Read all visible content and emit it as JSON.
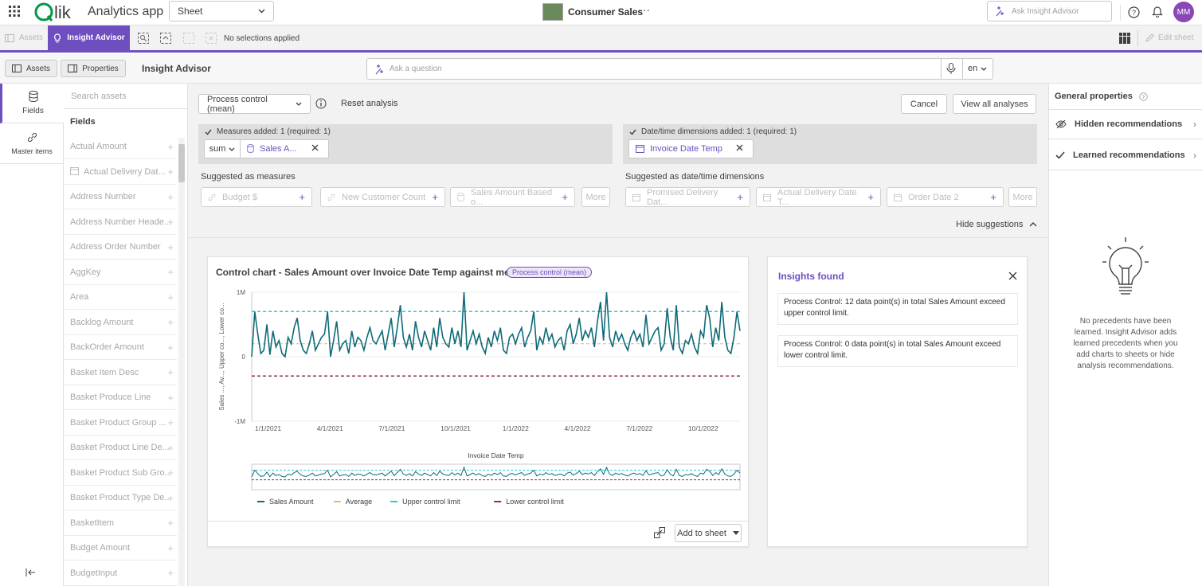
{
  "app": {
    "name": "Analytics app",
    "sheet_select": "Sheet",
    "doc_title": "Consumer Sales",
    "ask_placeholder": "Ask Insight Advisor",
    "avatar": "MM"
  },
  "toolbar": {
    "assets": "Assets",
    "insight_advisor": "Insight Advisor",
    "no_selections": "No selections applied",
    "edit_sheet": "Edit sheet"
  },
  "subbar": {
    "assets_tab": "Assets",
    "properties_tab": "Properties",
    "title": "Insight Advisor",
    "question_placeholder": "Ask a question",
    "language": "en"
  },
  "rail": {
    "fields": "Fields",
    "master_items": "Master items"
  },
  "fields_panel": {
    "search_placeholder": "Search assets",
    "heading": "Fields",
    "items": [
      "Actual Amount",
      "Actual Delivery Dat...",
      "Address Number",
      "Address Number Heade...",
      "Address Order Number",
      "AggKey",
      "Area",
      "Backlog Amount",
      "BackOrder Amount",
      "Basket Item Desc",
      "Basket Produce Line",
      "Basket Product Group ...",
      "Basket Product Line De...",
      "Basket Product Sub Gro...",
      "Basket Product Type De...",
      "BasketItem",
      "Budget Amount",
      "BudgetInput"
    ]
  },
  "analysis": {
    "type": "Process control (mean)",
    "reset": "Reset analysis",
    "cancel": "Cancel",
    "view_all": "View all analyses",
    "measures_header": "Measures added: 1 (required: 1)",
    "measure_agg": "sum",
    "measure_name": "Sales A...",
    "dims_header": "Date/time dimensions added: 1 (required: 1)",
    "dim_name": "Invoice Date Temp",
    "suggested_measures_label": "Suggested as measures",
    "suggested_measures": [
      "Budget $",
      "New Customer Count",
      "Sales Amount Based o..."
    ],
    "suggested_dims_label": "Suggested as date/time dimensions",
    "suggested_dims": [
      "Promised Delivery Dat...",
      "Actual Delivery Date T...",
      "Order Date 2"
    ],
    "more": "More",
    "hide_suggestions": "Hide suggestions"
  },
  "chart_card": {
    "title": "Control chart - Sales Amount over Invoice Date Temp against mean",
    "badge": "Process control (mean)",
    "add_to_sheet": "Add to sheet"
  },
  "chart_data": {
    "type": "line",
    "ylabel": "Sales ..., Av..., Upper co..., Lower co...",
    "xlabel": "Invoice Date Temp",
    "ylim": [
      -1000000,
      1000000
    ],
    "yticks": [
      "1M",
      "0",
      "-1M"
    ],
    "xticks": [
      "1/1/2021",
      "4/1/2021",
      "7/1/2021",
      "10/1/2021",
      "1/1/2022",
      "4/1/2022",
      "7/1/2022",
      "10/1/2022"
    ],
    "series": [
      {
        "name": "Sales Amount",
        "color": "#0e6b78",
        "values": [
          0,
          700000,
          350000,
          50000,
          100000,
          500000,
          30000,
          400000,
          150000,
          250000,
          50000,
          0,
          300000,
          200000,
          450000,
          600000,
          250000,
          100000,
          50000,
          200000,
          400000,
          100000,
          200000,
          300000,
          350000,
          700000,
          0,
          250000,
          550000,
          100000,
          200000,
          250000,
          50000,
          400000,
          150000,
          300000,
          250000,
          100000,
          300000,
          450000,
          250000,
          200000,
          300000,
          400000,
          100000,
          350000,
          600000,
          150000,
          450000,
          800000,
          300000,
          150000,
          350000,
          100000,
          550000,
          300000,
          150000,
          400000,
          250000,
          100000,
          450000,
          150000,
          600000,
          300000,
          200000,
          150000,
          450000,
          200000,
          400000,
          150000,
          1000000,
          100000,
          250000,
          400000,
          200000,
          350000,
          150000,
          50000,
          300000,
          150000,
          400000,
          250000,
          450000,
          100000,
          50000,
          300000,
          350000,
          200000,
          350000,
          450000,
          150000,
          300000,
          400000,
          700000,
          100000,
          300000,
          200000,
          450000,
          250000,
          350000,
          150000,
          250000,
          300000,
          100000,
          400000,
          500000,
          200000,
          350000,
          600000,
          250000,
          400000,
          300000,
          450000,
          150000,
          550000,
          850000,
          250000,
          1000000,
          300000,
          150000,
          400000,
          250000,
          350000,
          200000,
          100000,
          300000,
          400000,
          250000,
          350000,
          150000,
          650000,
          200000,
          300000,
          400000,
          450000,
          100000,
          200000,
          750000,
          300000,
          100000,
          800000,
          150000,
          50000,
          250000,
          200000,
          350000,
          150000,
          50000,
          400000,
          300000,
          800000,
          600000,
          150000,
          450000,
          250000,
          850000,
          300000,
          100000,
          50000,
          300000,
          700000,
          400000
        ]
      },
      {
        "name": "Average",
        "color": "#e7b37a",
        "values": []
      },
      {
        "name": "Upper control limit",
        "color": "#2fc8d4",
        "values": []
      },
      {
        "name": "Lower control limit",
        "color": "#8e2a5c",
        "values": []
      }
    ],
    "mean": 200000,
    "upper_control_limit": 700000,
    "lower_control_limit": -300000
  },
  "insights": {
    "title": "Insights found",
    "items": [
      "Process Control: 12 data point(s) in total Sales Amount exceed upper control limit.",
      "Process Control: 0 data point(s) in total Sales Amount exceed lower control limit."
    ]
  },
  "right_panel": {
    "general_properties": "General properties",
    "hidden_recs": "Hidden recommendations",
    "learned_recs": "Learned recommendations",
    "empty_text": "No precedents have been learned. Insight Advisor adds learned precedents when you add charts to sheets or hide analysis recommendations."
  }
}
